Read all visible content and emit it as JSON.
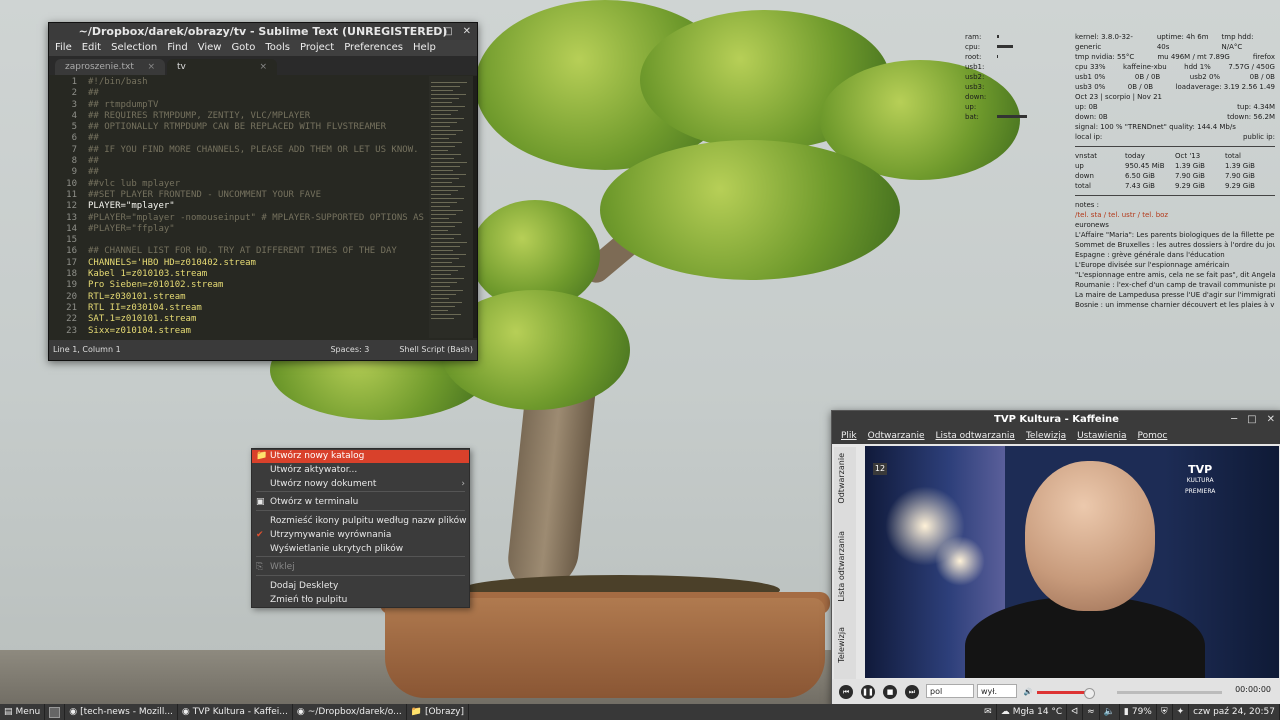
{
  "sublime": {
    "title": "~/Dropbox/darek/obrazy/tv - Sublime Text (UNREGISTERED)",
    "menu": [
      "File",
      "Edit",
      "Selection",
      "Find",
      "View",
      "Goto",
      "Tools",
      "Project",
      "Preferences",
      "Help"
    ],
    "tabs": [
      {
        "label": "zaproszenie.txt",
        "active": false
      },
      {
        "label": "tv",
        "active": true
      }
    ],
    "lines": [
      {
        "n": "1",
        "t": "#!/bin/bash",
        "k": "c"
      },
      {
        "n": "2",
        "t": "##",
        "k": "c"
      },
      {
        "n": "3",
        "t": "## rtmpdumpTV",
        "k": "c"
      },
      {
        "n": "4",
        "t": "## REQUIRES RTMPDUMP, ZENTIY, VLC/MPLAYER",
        "k": "c"
      },
      {
        "n": "5",
        "t": "## OPTIONALLY RTMPDUMP CAN BE REPLACED WITH FLVSTREAMER",
        "k": "c"
      },
      {
        "n": "6",
        "t": "##",
        "k": "c"
      },
      {
        "n": "7",
        "t": "## IF YOU FIND MORE CHANNELS, PLEASE ADD THEM OR LET US KNOW.",
        "k": "c"
      },
      {
        "n": "8",
        "t": "##",
        "k": "c"
      },
      {
        "n": "9",
        "t": "##",
        "k": "c"
      },
      {
        "n": "10",
        "t": "##vlc lub mplayer",
        "k": "c"
      },
      {
        "n": "11",
        "t": "##SET PLAYER FRONTEND - UNCOMMENT YOUR FAVE",
        "k": "c"
      },
      {
        "n": "12",
        "t": "PLAYER=\"mplayer\"",
        "k": ""
      },
      {
        "n": "13",
        "t": "#PLAYER=\"mplayer -nomouseinput\" # MPLAYER-SUPPORTED OPTIONS AS",
        "k": "c"
      },
      {
        "n": "14",
        "t": "#PLAYER=\"ffplay\"",
        "k": "c"
      },
      {
        "n": "15",
        "t": "",
        "k": ""
      },
      {
        "n": "16",
        "t": "## CHANNEL LIST FOR HD. TRY AT DIFFERENT TIMES OF THE DAY",
        "k": "c"
      },
      {
        "n": "17",
        "t": "CHANNELS='HBO HD=z010402.stream",
        "k": "s"
      },
      {
        "n": "18",
        "t": "Kabel 1=z010103.stream",
        "k": "s"
      },
      {
        "n": "19",
        "t": "Pro Sieben=z010102.stream",
        "k": "s"
      },
      {
        "n": "20",
        "t": "RTL=z030101.stream",
        "k": "s"
      },
      {
        "n": "21",
        "t": "RTL II=z030104.stream",
        "k": "s"
      },
      {
        "n": "22",
        "t": "SAT.1=z010101.stream",
        "k": "s"
      },
      {
        "n": "23",
        "t": "Sixx=z010104.stream",
        "k": "s"
      }
    ],
    "status_left": "Line 1, Column 1",
    "status_spaces": "Spaces: 3",
    "status_syntax": "Shell Script (Bash)"
  },
  "conky": {
    "left_labels": [
      "ram:",
      "cpu:",
      "root:",
      "usb1:",
      "usb2:",
      "usb3:",
      "down:",
      "up:",
      "bat:"
    ],
    "left_bar_fraction": [
      0.05,
      0.5,
      0.02,
      0,
      0,
      0,
      0,
      0,
      0.95
    ],
    "right_rows": [
      [
        "kernel: 3.8.0-32-generic",
        "uptime: 4h 6m 40s",
        "tmp hdd: N/A°C"
      ],
      [
        "tmp nvidia: 55°C",
        "mu 496M / mt 7.89G",
        "firefox"
      ],
      [
        "cpu 33%",
        "kaffeine-xbu",
        "hdd 1%",
        "7.57G / 450G"
      ],
      [
        "usb1 0%",
        "0B / 0B",
        "usb2 0%",
        "0B / 0B"
      ],
      [
        "usb3 0%",
        "0B / 0B",
        "loadaverage: 3.19 2.56 1.49"
      ],
      [
        "Oct 23 | scorpio | Nov 21"
      ],
      [
        "up: 0B",
        "tup: 4.34M"
      ],
      [
        "down: 0B",
        "tdown: 56.2M"
      ],
      [
        "signal: 100 % \"TRENDnet\" quality: 144.4 Mb/s"
      ],
      [
        "local ip:",
        "public ip:"
      ]
    ],
    "vnstat_header": [
      "vnstat",
      "today",
      "Oct '13",
      "total"
    ],
    "vnstat_rows": [
      [
        "up",
        "950.45 MiB",
        "1.39 GiB",
        "1.39 GiB"
      ],
      [
        "down",
        "6.50 GiB",
        "7.90 GiB",
        "7.90 GiB"
      ],
      [
        "total",
        "7.43 GiB",
        "9.29 GiB",
        "9.29 GiB"
      ]
    ],
    "notes_label": "notes :",
    "notes_link": "/tel. sta / tel. ustr / tel. boz",
    "news_source": "euronews",
    "news": [
      "L'Affaire \"Maria\": Les parents biologiques de la fillette peut-être lo",
      "Sommet de Bruxelles : les autres dossiers à l'ordre du jour",
      "Espagne : grève générale dans l'éducation",
      "L'Europe divisée sur l'espionnage américain",
      "\"L'espionnage entre amis, cela ne se fait pas\", dit Angela Merkel",
      "Roumanie : l'ex-chef d'un camp de travail communiste poursuivi po",
      "La maire de Lampedusa presse l'UE d'agir sur l'immigration",
      "Bosnie : un immense charnier découvert et les plaies à vif"
    ]
  },
  "context_menu": {
    "items": [
      {
        "label": "Utwórz nowy katalog",
        "icon": "folder",
        "highlight": true
      },
      {
        "label": "Utwórz aktywator...",
        "icon": ""
      },
      {
        "label": "Utwórz nowy dokument",
        "icon": "",
        "submenu": true
      },
      {
        "label": "Otwórz w terminalu",
        "icon": "terminal"
      },
      {
        "label": "Rozmieść ikony pulpitu według nazw plików",
        "icon": ""
      },
      {
        "label": "Utrzymywanie wyrównania",
        "icon": "check"
      },
      {
        "label": "Wyświetlanie ukrytych plików",
        "icon": ""
      },
      {
        "label": "Wklej",
        "icon": "paste",
        "disabled": true
      },
      {
        "label": "Dodaj Desklety",
        "icon": ""
      },
      {
        "label": "Zmień tło pulpitu",
        "icon": ""
      }
    ]
  },
  "kaffeine": {
    "title": "TVP Kultura - Kaffeine",
    "menu": [
      "Plik",
      "Odtwarzanie",
      "Lista odtwarzania",
      "Telewizja",
      "Ustawienia",
      "Pomoc"
    ],
    "side_tabs": [
      "Odtwarzanie",
      "Lista odtwarzania",
      "Telewizja"
    ],
    "age_badge": "12",
    "logo_line1": "TVP",
    "logo_line2": "KULTURA",
    "logo_line3": "PREMIERA",
    "lang": "pol",
    "subs": "wył.",
    "volume_fraction": 0.8,
    "time": "00:00:00"
  },
  "taskbar": {
    "menu": "Menu",
    "items": [
      "[tech-news - Mozill...",
      "TVP Kultura - Kaffei...",
      "~/Dropbox/darek/o...",
      "[Obrazy]"
    ],
    "weather": "Mgła 14 °C",
    "battery": "79%",
    "clock": "czw paź 24, 20:57"
  },
  "colors": {
    "accent": "#d9412b",
    "editor_bg": "#272822",
    "panel": "#383838"
  }
}
